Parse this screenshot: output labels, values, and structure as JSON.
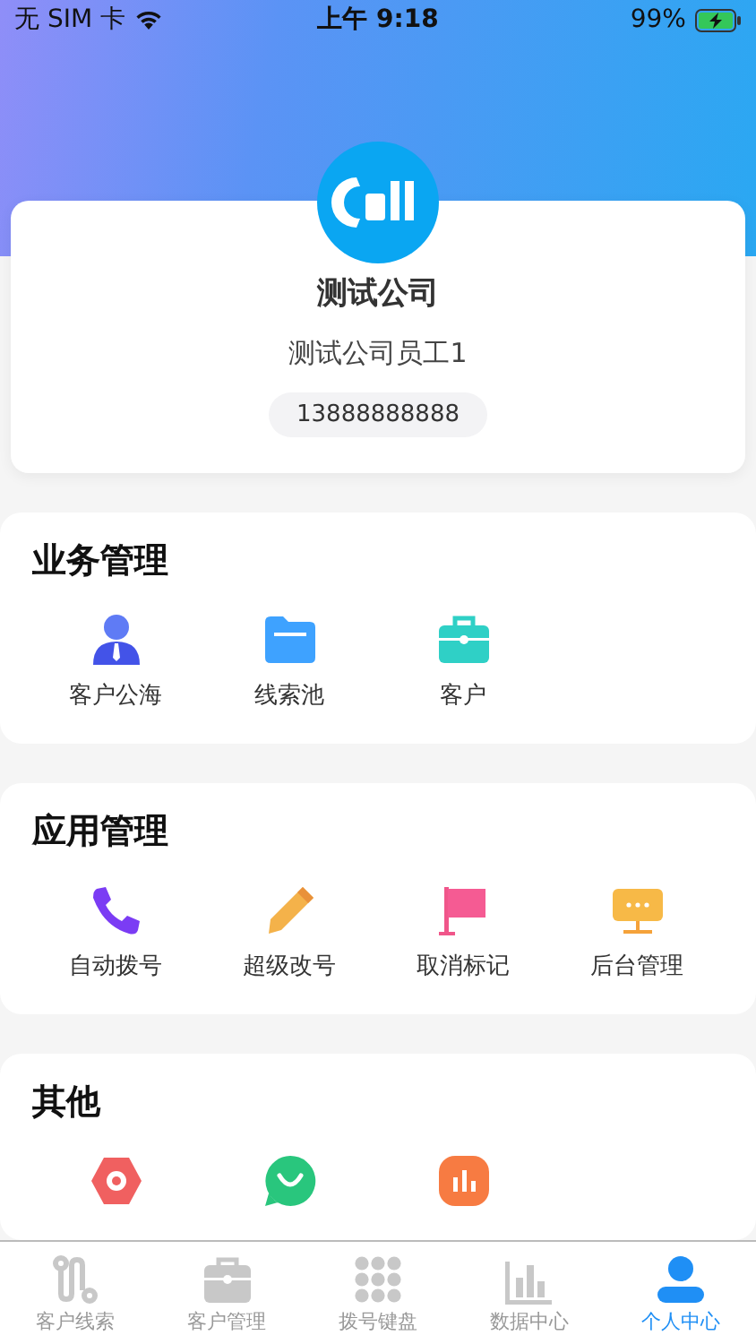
{
  "status_bar": {
    "carrier": "无 SIM 卡",
    "time": "上午 9:18",
    "battery": "99%"
  },
  "profile": {
    "company": "测试公司",
    "employee": "测试公司员工1",
    "phone": "13888888888"
  },
  "sections": [
    {
      "title": "业务管理",
      "items": [
        {
          "kind": "person",
          "label": "客户公海"
        },
        {
          "kind": "folder",
          "label": "线索池"
        },
        {
          "kind": "briefcase",
          "label": "客户"
        }
      ]
    },
    {
      "title": "应用管理",
      "items": [
        {
          "kind": "phone",
          "label": "自动拨号"
        },
        {
          "kind": "pencil",
          "label": "超级改号"
        },
        {
          "kind": "flag",
          "label": "取消标记"
        },
        {
          "kind": "monitor",
          "label": "后台管理"
        }
      ]
    },
    {
      "title": "其他",
      "items": [
        {
          "kind": "settings"
        },
        {
          "kind": "chat"
        },
        {
          "kind": "chart"
        }
      ]
    }
  ],
  "tabs": [
    {
      "kind": "route",
      "label": "客户线索",
      "selected": false
    },
    {
      "kind": "briefcase",
      "label": "客户管理",
      "selected": false
    },
    {
      "kind": "keypad",
      "label": "拨号键盘",
      "selected": false
    },
    {
      "kind": "chart",
      "label": "数据中心",
      "selected": false
    },
    {
      "kind": "person",
      "label": "个人中心",
      "selected": true
    }
  ]
}
